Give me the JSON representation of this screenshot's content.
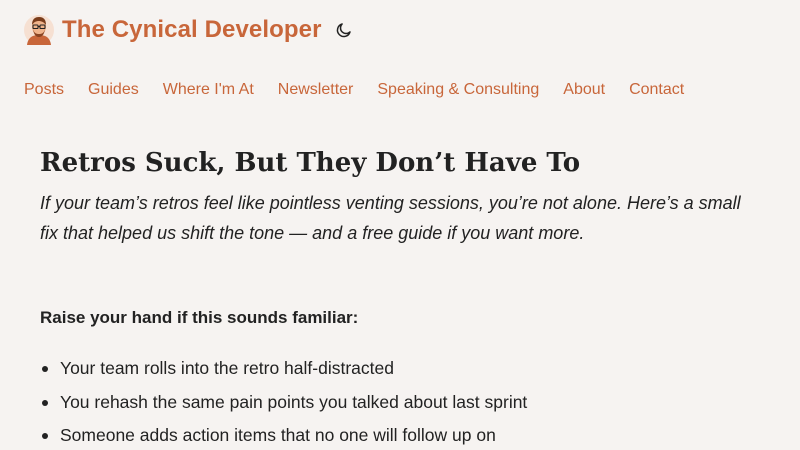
{
  "site": {
    "title": "The Cynical Developer",
    "avatar_icon": "developer-avatar-icon",
    "theme_toggle_icon": "moon-icon"
  },
  "nav": {
    "items": [
      {
        "label": "Posts"
      },
      {
        "label": "Guides"
      },
      {
        "label": "Where I'm At"
      },
      {
        "label": "Newsletter"
      },
      {
        "label": "Speaking & Consulting"
      },
      {
        "label": "About"
      },
      {
        "label": "Contact"
      }
    ]
  },
  "article": {
    "title": "Retros Suck, But They Don’t Have To",
    "subtitle": "If your team’s retros feel like pointless venting sessions, you’re not alone. Here’s a small fix that helped us shift the tone — and a free guide if you want more.",
    "lead": "Raise your hand if this sounds familiar:",
    "bullets": [
      "Your team rolls into the retro half-distracted",
      "You rehash the same pain points you talked about last sprint",
      "Someone adds action items that no one will follow up on"
    ]
  },
  "colors": {
    "background": "#f6f3f1",
    "accent": "#c8663a",
    "text": "#222222"
  }
}
